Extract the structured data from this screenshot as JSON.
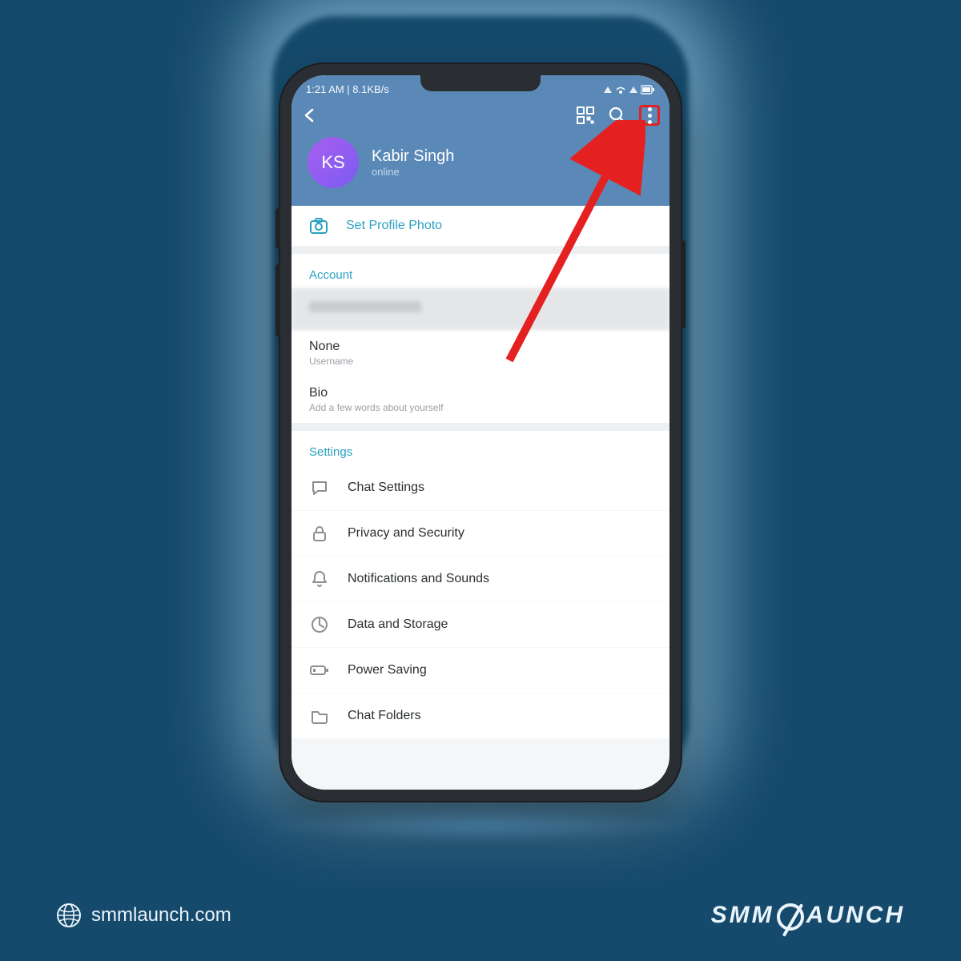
{
  "status_bar": {
    "left": "1:21 AM | 8.1KB/s"
  },
  "header": {
    "profile_initials": "KS",
    "profile_name": "Kabir Singh",
    "profile_status": "online"
  },
  "set_photo_label": "Set Profile Photo",
  "account": {
    "section_label": "Account",
    "username_value": "None",
    "username_label": "Username",
    "bio_value": "Bio",
    "bio_label": "Add a few words about yourself"
  },
  "settings": {
    "section_label": "Settings",
    "items": [
      {
        "label": "Chat Settings"
      },
      {
        "label": "Privacy and Security"
      },
      {
        "label": "Notifications and Sounds"
      },
      {
        "label": "Data and Storage"
      },
      {
        "label": "Power Saving"
      },
      {
        "label": "Chat Folders"
      }
    ]
  },
  "footer": {
    "url": "smmlaunch.com",
    "brand_left": "SMM",
    "brand_right": "AUNCH"
  }
}
